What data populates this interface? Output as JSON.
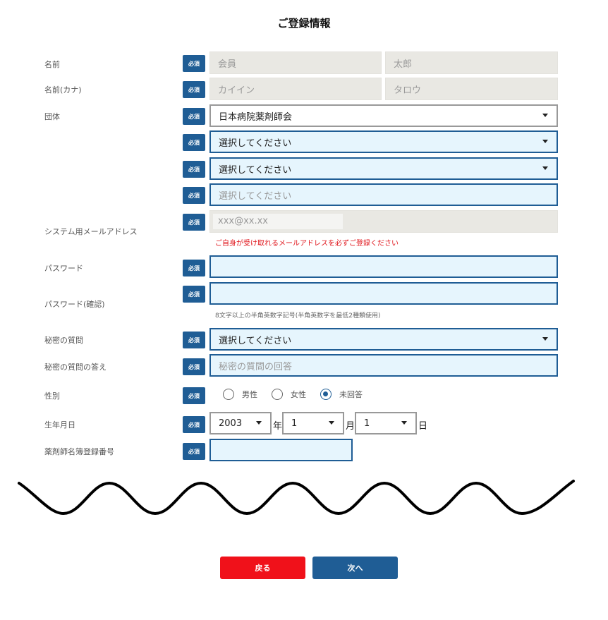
{
  "title": "ご登録情報",
  "required_badge": "必須",
  "labels": {
    "name": "名前",
    "name_kana": "名前(カナ)",
    "organization": "団体",
    "system_email": "システム用メールアドレス",
    "password": "パスワード",
    "password_confirm": "パスワード(確認)",
    "secret_question": "秘密の質問",
    "secret_answer": "秘密の質問の答え",
    "gender": "性別",
    "birthdate": "生年月日",
    "registry_number": "薬剤師名簿登録番号"
  },
  "fields": {
    "last_name": "会員",
    "first_name": "太郎",
    "last_name_kana": "カイイン",
    "first_name_kana": "タロウ",
    "organization_1": "日本病院薬剤師会",
    "organization_2": "選択してください",
    "organization_3": "選択してください",
    "organization_4_placeholder": "選択してください",
    "email": "xxx@xx.xx",
    "email_note": "ご自身が受け取れるメールアドレスを必ずご登録ください",
    "password": "",
    "password_confirm": "",
    "password_note": "8文字以上の半角英数字記号(半角英数字を最低2種類使用)",
    "secret_question": "選択してください",
    "secret_answer_placeholder": "秘密の質問の回答",
    "registry_number": ""
  },
  "gender_options": [
    {
      "label": "男性",
      "checked": false
    },
    {
      "label": "女性",
      "checked": false
    },
    {
      "label": "未回答",
      "checked": true
    }
  ],
  "birthdate": {
    "year": "2003",
    "year_suffix": "年",
    "month": "1",
    "month_suffix": "月",
    "day": "1",
    "day_suffix": "日"
  },
  "buttons": {
    "back": "戻る",
    "next": "次へ"
  },
  "colors": {
    "primary": "#1f5d95",
    "back_button": "#f0111a",
    "next_button": "#1f5d95",
    "error_text": "#e0151b",
    "input_bg": "#e6f5fd",
    "disabled_bg": "#e9e8e3"
  }
}
